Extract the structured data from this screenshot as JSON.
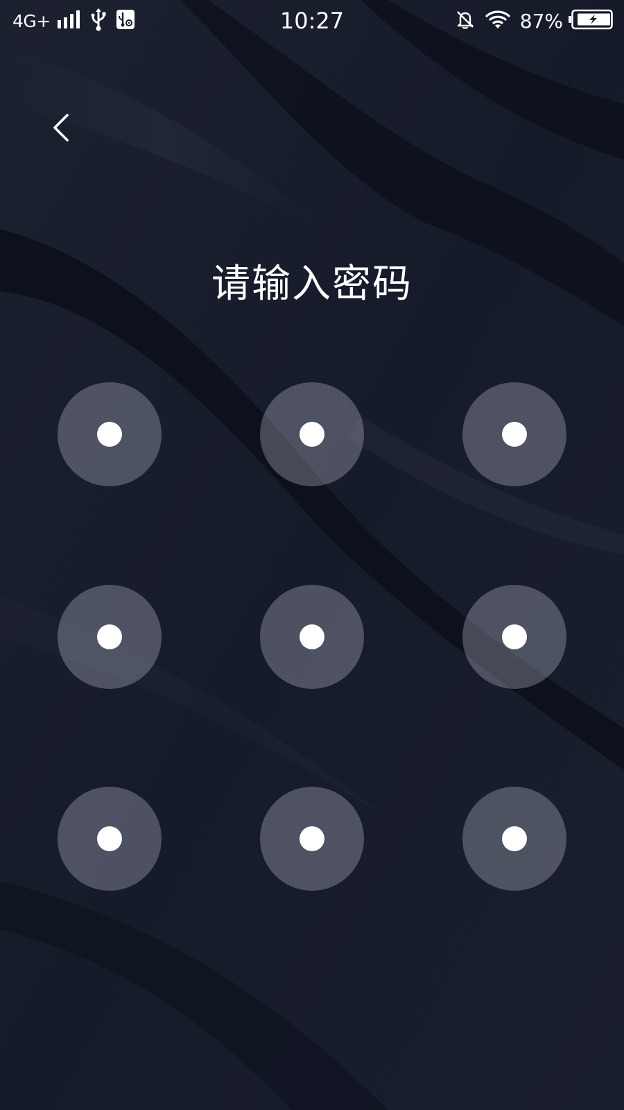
{
  "status_bar": {
    "network": "4G+",
    "time": "10:27",
    "battery_percent": "87%",
    "icons": [
      "signal-bars-icon",
      "usb-icon",
      "usb-debug-icon",
      "bell-muted-icon",
      "wifi-icon",
      "battery-charging-icon"
    ]
  },
  "header": {
    "back_icon": "chevron-left-icon"
  },
  "main": {
    "title": "请输入密码",
    "pattern_nodes": 9
  },
  "colors": {
    "background": "#151a28",
    "node_fill": "rgba(205,210,225,0.30)",
    "dot": "#ffffff",
    "text": "#ffffff"
  }
}
